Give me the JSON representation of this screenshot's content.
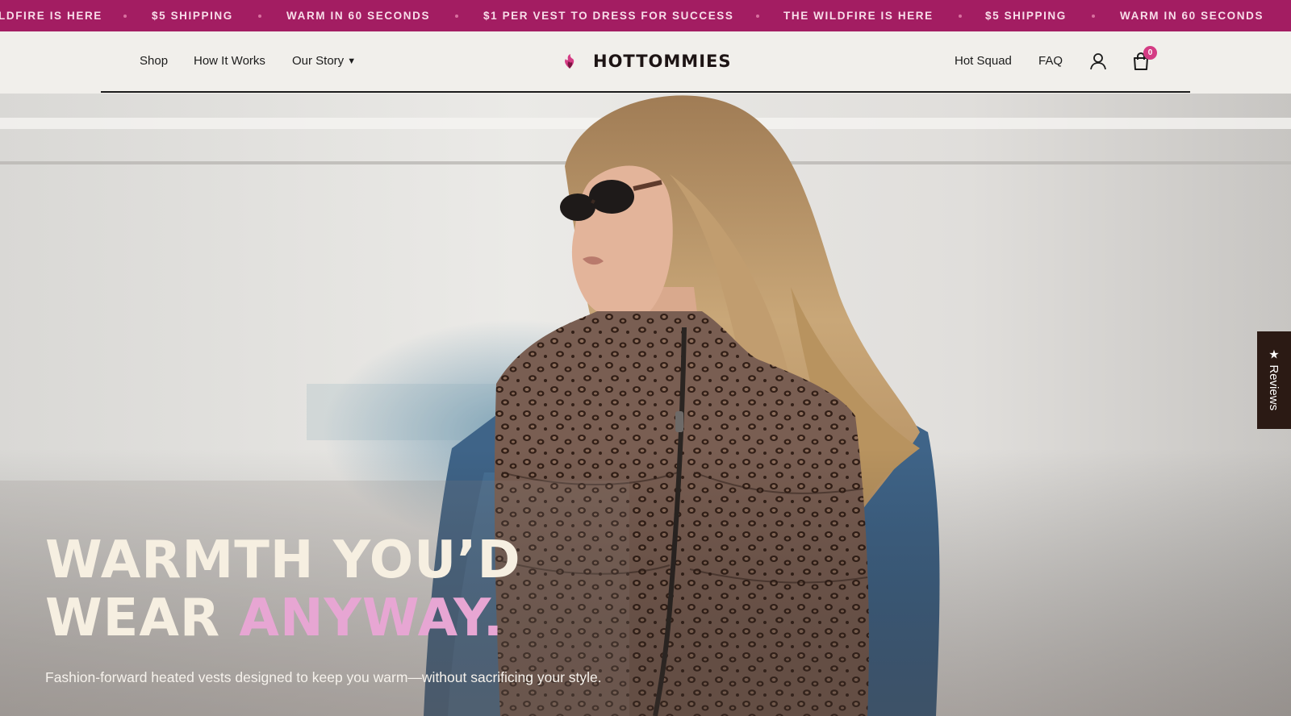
{
  "announcement_bar": {
    "background_color": "#a31d62",
    "items": [
      "LDFIRE IS HERE",
      "$5 SHIPPING",
      "WARM IN 60 SECONDS",
      "$1 PER VEST TO DRESS FOR SUCCESS",
      "THE WILDFIRE IS HERE",
      "$5 SHIPPING",
      "WARM IN 60 SECONDS"
    ]
  },
  "header": {
    "nav_left": {
      "shop": "Shop",
      "how_it_works": "How It Works",
      "our_story": "Our Story",
      "our_story_caret": "▼"
    },
    "logo": {
      "text": "HOTTOMMIES",
      "mark_icon": "flame-heart-logo-icon",
      "mark_color": "#d43c84"
    },
    "nav_right": {
      "hot_squad": "Hot Squad",
      "faq": "FAQ",
      "account_icon": "user-icon",
      "cart_icon": "shopping-bag-icon",
      "cart_count": "0"
    }
  },
  "hero": {
    "headline_line1": "WARMTH YOU’D",
    "headline_line2_start": "WEAR ",
    "headline_line2_accent": "ANYWAY.",
    "headline_color": "#f6efe1",
    "accent_color": "#e7a6d3",
    "subtext": "Fashion-forward heated vests designed to keep you warm—without sacrificing your style."
  },
  "reviews_tab": {
    "label": "Reviews",
    "star": "★"
  }
}
